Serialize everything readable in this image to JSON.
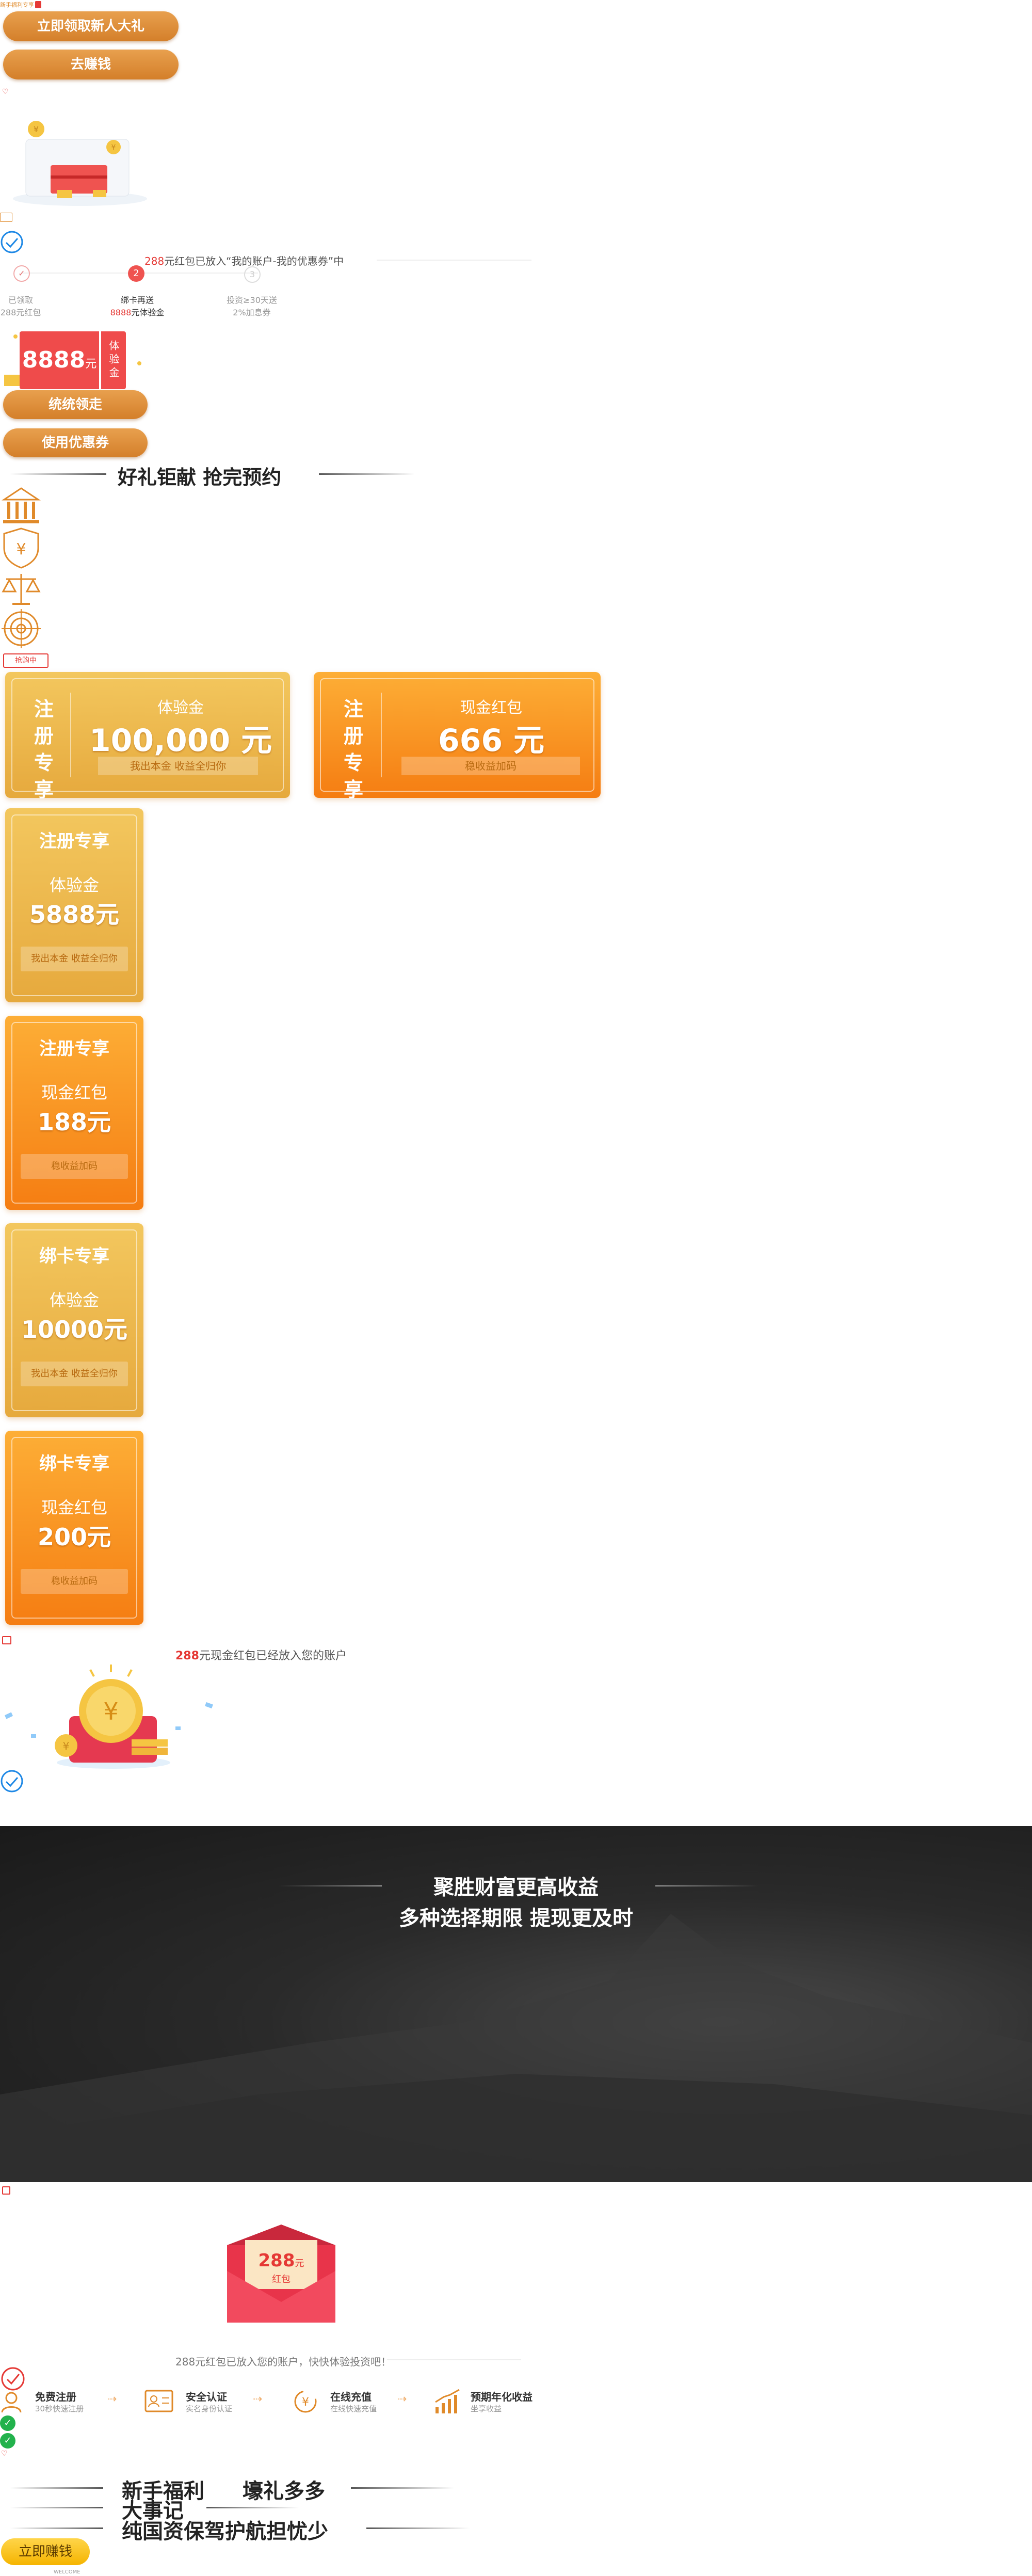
{
  "top_badge": "新手福利专享",
  "buttons": {
    "claim_gift": "立即领取新人大礼",
    "earn": "去赚钱",
    "claim_all": "统统领走",
    "use_coupon": "使用优惠券",
    "earn_now": "立即赚钱"
  },
  "notice1": {
    "amount": "288",
    "text": "元红包已放入“我的账户-我的优惠券”中"
  },
  "steps": [
    {
      "line1": "已领取",
      "line2": "288元红包",
      "active": false
    },
    {
      "num": "2",
      "line1": "绑卡再送",
      "line2_amount": "8888",
      "line2_text": "元体验金",
      "active": true
    },
    {
      "num": "3",
      "line1": "投资≥30天送",
      "line2": "2%加息券",
      "active": false
    }
  ],
  "exp_coupon": {
    "amount": "8888",
    "unit": "元",
    "tag": "体验金"
  },
  "section1_title": "好礼钜献 抢完预约",
  "grab_tag": "抢购中",
  "wide_cards": [
    {
      "side": "注册专享",
      "label": "体验金",
      "amount": "100,000 元",
      "note": "我出本金 收益全归你",
      "style": "gold"
    },
    {
      "side": "注册专享",
      "label": "现金红包",
      "amount": "666 元",
      "note": "稳收益加码",
      "style": "orange"
    }
  ],
  "tall_cards": [
    {
      "title": "注册专享",
      "label": "体验金",
      "amount": "5888元",
      "note": "我出本金 收益全归你",
      "style": "gold"
    },
    {
      "title": "注册专享",
      "label": "现金红包",
      "amount": "188元",
      "note": "稳收益加码",
      "style": "orange"
    },
    {
      "title": "绑卡专享",
      "label": "体验金",
      "amount": "10000元",
      "note": "我出本金 收益全归你",
      "style": "gold"
    },
    {
      "title": "绑卡专享",
      "label": "现金红包",
      "amount": "200元",
      "note": "稳收益加码",
      "style": "orange"
    }
  ],
  "notice2": {
    "amount": "288",
    "text": "元现金红包已经放入您的账户"
  },
  "banner": {
    "line1": "聚胜财富更高收益",
    "line2": "多种选择期限 提现更及时"
  },
  "envelope": {
    "amount": "288",
    "unit": "元",
    "label": "红包"
  },
  "notice3": "288元红包已放入您的账户，快快体验投资吧！",
  "advantages": [
    {
      "title": "免费注册",
      "sub": "30秒快速注册"
    },
    {
      "title": "安全认证",
      "sub": "实名身份认证"
    },
    {
      "title": "在线充值",
      "sub": "在线快速充值"
    },
    {
      "title": "预期年化收益",
      "sub": "坐享收益"
    }
  ],
  "bottom_titles": {
    "t1": "新手福利",
    "t2": "壕礼多多",
    "t3": "大事记",
    "t4": "纯国资保驾护航担忧少"
  },
  "footer_small": "WELCOME",
  "colors": {
    "gold": "#e6a93d",
    "orange": "#f57d12",
    "red": "#e53935",
    "accent_text": "#e53935"
  }
}
